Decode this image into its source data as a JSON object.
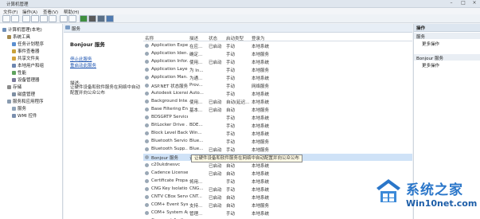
{
  "window": {
    "title": "计算机管理"
  },
  "menu": [
    "文件(F)",
    "操作(A)",
    "查看(V)",
    "帮助(H)"
  ],
  "tree": [
    {
      "label": "计算机管理(本地)",
      "indent": 0,
      "icon_color": "#6f8fb8"
    },
    {
      "label": "系统工具",
      "indent": 1,
      "icon_color": "#a58a4f"
    },
    {
      "label": "任务计划程序",
      "indent": 2,
      "icon_color": "#5b8fd0"
    },
    {
      "label": "事件查看器",
      "indent": 2,
      "icon_color": "#c9a13a"
    },
    {
      "label": "共享文件夹",
      "indent": 2,
      "icon_color": "#d2a23d"
    },
    {
      "label": "本地用户和组",
      "indent": 2,
      "icon_color": "#6d86b0"
    },
    {
      "label": "性能",
      "indent": 2,
      "icon_color": "#5fa35f"
    },
    {
      "label": "设备管理器",
      "indent": 2,
      "icon_color": "#7a7a9a"
    },
    {
      "label": "存储",
      "indent": 1,
      "icon_color": "#8a8a8a"
    },
    {
      "label": "磁盘管理",
      "indent": 2,
      "icon_color": "#7e8fa3"
    },
    {
      "label": "服务和应用程序",
      "indent": 1,
      "icon_color": "#8a9cb0"
    },
    {
      "label": "服务",
      "indent": 2,
      "icon_color": "#8fa3b8"
    },
    {
      "label": "WMI 控件",
      "indent": 2,
      "icon_color": "#7a8fae"
    }
  ],
  "center": {
    "title": "服务",
    "service_name": "Bonjour 服务",
    "stop_link": "停止此服务",
    "restart_link": "重启动此服务",
    "desc_label": "描述:",
    "desc_text": "让硬件设备和软件服务在网络中自动配置并向公众公布"
  },
  "columns": [
    "名称",
    "描述",
    "状态",
    "启动类型",
    "登录为"
  ],
  "services": [
    [
      "Application Expe...",
      "在应...",
      "已启动",
      "手动",
      "本地系统"
    ],
    [
      "Application Iden...",
      "确定...",
      "",
      "手动",
      "本地服务"
    ],
    [
      "Application Infor...",
      "使用...",
      "已启动",
      "手动",
      "本地系统"
    ],
    [
      "Application Laye...",
      "为 In...",
      "",
      "手动",
      "本地服务"
    ],
    [
      "Application Man...",
      "为通...",
      "",
      "手动",
      "本地系统"
    ],
    [
      "ASP.NET 状态服务",
      "Prov...",
      "",
      "手动",
      "网络服务"
    ],
    [
      "Autodesk Licensi...",
      "Auto...",
      "",
      "手动",
      "本地系统"
    ],
    [
      "Background Inte...",
      "使用...",
      "已启动",
      "自动(延迟...",
      "本地系统"
    ],
    [
      "Base Filtering En...",
      "基本...",
      "已启动",
      "自动",
      "本地服务"
    ],
    [
      "BDSGRTP Service",
      "",
      "",
      "手动",
      "本地系统"
    ],
    [
      "BitLocker Drive ...",
      "BDE...",
      "",
      "手动",
      "本地系统"
    ],
    [
      "Block Level Back...",
      "Win...",
      "",
      "手动",
      "本地系统"
    ],
    [
      "Bluetooth Service",
      "Blue...",
      "",
      "手动",
      "本地服务"
    ],
    [
      "Bluetooth Supp...",
      "Blue...",
      "已启动",
      "手动",
      "本地服务"
    ],
    [
      "Bonjour 服务",
      "让硬...",
      "",
      "",
      ""
    ],
    [
      "c20ukdnesvc",
      "",
      "已启动",
      "自动",
      "本地系统"
    ],
    [
      "Cadence License...",
      "",
      "已启动",
      "自动",
      "本地系统"
    ],
    [
      "Certificate Propa...",
      "将用...",
      "",
      "手动",
      "本地系统"
    ],
    [
      "CNG Key Isolation",
      "CNG...",
      "已启动",
      "手动",
      "本地系统"
    ],
    [
      "CNTV CBox Server",
      "CNT...",
      "已启动",
      "自动",
      "本地系统"
    ],
    [
      "COM+ Event Sys...",
      "支持...",
      "已启动",
      "自动",
      "本地服务"
    ],
    [
      "COM+ System Ap...",
      "管理...",
      "",
      "手动",
      "本地系统"
    ],
    [
      "Conexant Audio ...",
      "",
      "已启动",
      "自动",
      "本地系统"
    ]
  ],
  "tooltip": "让硬件设备和软件服务在网络中自动配置并向公众公布",
  "actions": {
    "header": "操作",
    "section1": "服务",
    "more1": "更多操作",
    "section2": "Bonjour 服务",
    "more2": "更多操作"
  },
  "watermark": {
    "title": "系统之家",
    "url": "Win10net.com"
  }
}
